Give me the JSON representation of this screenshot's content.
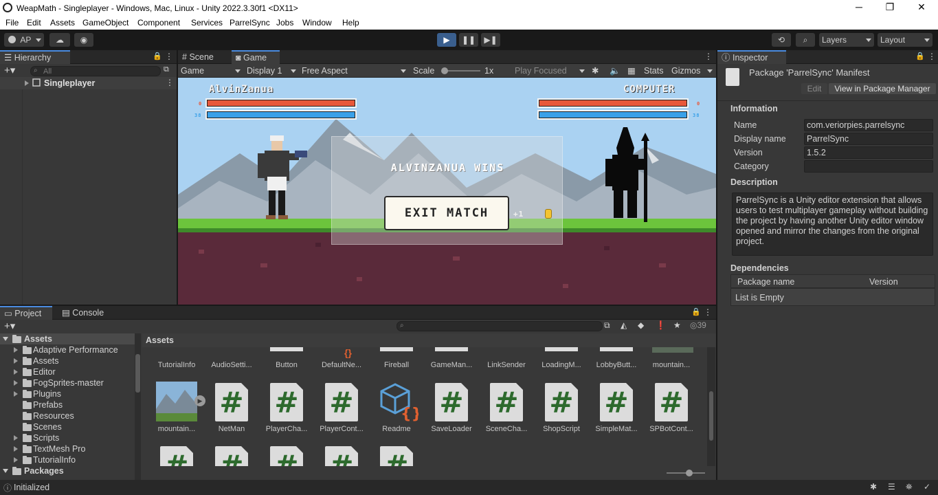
{
  "window": {
    "title": "WeapMath - Singleplayer - Windows, Mac, Linux - Unity 2022.3.30f1 <DX11>",
    "minimize": "─",
    "restore": "❐",
    "close": "✕"
  },
  "menu": [
    "File",
    "Edit",
    "Assets",
    "GameObject",
    "Component",
    "Services",
    "ParrelSync",
    "Jobs",
    "Window",
    "Help"
  ],
  "toolbar": {
    "account": "AP",
    "layers": "Layers",
    "layout": "Layout"
  },
  "hierarchy": {
    "tab": "Hierarchy",
    "search_placeholder": "All",
    "root": "Singleplayer"
  },
  "game_view": {
    "tabs": [
      "Scene",
      "Game"
    ],
    "mode": "Game",
    "display": "Display 1",
    "aspect": "Free Aspect",
    "scale_label": "Scale",
    "scale_value": "1x",
    "play_focused": "Play Focused",
    "stats": "Stats",
    "gizmos": "Gizmos"
  },
  "game": {
    "player_name": "AlvinZanua",
    "enemy_name": "COMPUTER",
    "player_hp": "0",
    "player_mp": "38",
    "enemy_hp": "0",
    "enemy_mp": "38",
    "player_hp_fill": 1.0,
    "enemy_hp_fill": 1.0,
    "result": "ALVINZANUA WINS",
    "exit_button": "EXIT MATCH",
    "reward": "+1"
  },
  "inspector": {
    "tab": "Inspector",
    "title": "Package 'ParrelSync' Manifest",
    "edit": "Edit",
    "view_pm": "View in Package Manager",
    "information": "Information",
    "fields": [
      {
        "key": "Name",
        "value": "com.veriorpies.parrelsync"
      },
      {
        "key": "Display name",
        "value": "ParrelSync"
      },
      {
        "key": "Version",
        "value": "1.5.2"
      },
      {
        "key": "Category",
        "value": ""
      }
    ],
    "description_label": "Description",
    "description": "ParrelSync is a Unity editor extension that allows users to test multiplayer gameplay without building the project by having another Unity editor window opened and mirror the changes from the original project.",
    "dependencies_label": "Dependencies",
    "dep_col1": "Package name",
    "dep_col2": "Version",
    "dep_empty": "List is Empty"
  },
  "project": {
    "tabs": [
      "Project",
      "Console"
    ],
    "hidden_count": "39",
    "tree": [
      "Assets",
      "Adaptive Performance",
      "Assets",
      "Editor",
      "FogSprites-master",
      "Plugins",
      "Prefabs",
      "Resources",
      "Scenes",
      "Scripts",
      "TextMesh Pro",
      "TutorialInfo",
      "Packages"
    ],
    "breadcrumb": "Assets",
    "row1": [
      "TutorialInfo",
      "AudioSetti...",
      "Button",
      "DefaultNe...",
      "Fireball",
      "GameMan...",
      "LinkSender",
      "LoadingM...",
      "LobbyButt...",
      "mountain..."
    ],
    "row2": [
      "mountain...",
      "NetMan",
      "PlayerCha...",
      "PlayerCont...",
      "Readme",
      "SaveLoader",
      "SceneCha...",
      "ShopScript",
      "SimpleMat...",
      "SPBotCont..."
    ]
  },
  "status": {
    "text": "Initialized"
  },
  "colors": {
    "accent": "#4a8be0",
    "hp": "#e8583a",
    "mp": "#3aa0e8",
    "sky": "#aad2f2",
    "grass": "#6cc43c",
    "dirt": "#5a2a3a"
  }
}
